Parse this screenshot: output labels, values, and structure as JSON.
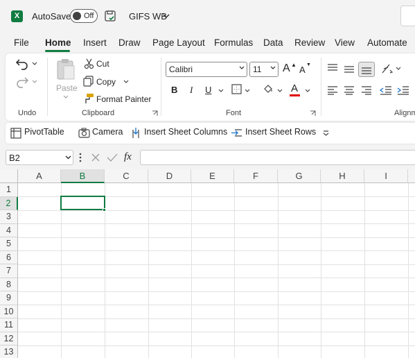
{
  "titlebar": {
    "app_icon_letter": "X",
    "autosave_label": "AutoSave",
    "autosave_state": "Off",
    "document_title": "GIFS WB"
  },
  "tabs": [
    "File",
    "Home",
    "Insert",
    "Draw",
    "Page Layout",
    "Formulas",
    "Data",
    "Review",
    "View",
    "Automate"
  ],
  "active_tab": "Home",
  "ribbon": {
    "undo_group": {
      "label": "Undo"
    },
    "clipboard": {
      "label": "Clipboard",
      "paste": "Paste",
      "cut": "Cut",
      "copy": "Copy",
      "format_painter": "Format Painter"
    },
    "font": {
      "label": "Font",
      "font_name": "Calibri",
      "font_size": "11",
      "bold": "B",
      "italic": "I",
      "underline": "U",
      "grow": "A",
      "shrink": "A",
      "font_color": "A",
      "font_color_value": "#e00000"
    },
    "alignment": {
      "label": "Alignm"
    }
  },
  "quick_access": {
    "items": [
      "PivotTable",
      "Camera",
      "Insert Sheet Columns",
      "Insert Sheet Rows"
    ]
  },
  "formula_bar": {
    "name_box": "B2",
    "fx": "fx",
    "value": ""
  },
  "grid": {
    "columns": [
      "A",
      "B",
      "C",
      "D",
      "E",
      "F",
      "G",
      "H",
      "I"
    ],
    "rows": [
      "1",
      "2",
      "3",
      "4",
      "5",
      "6",
      "7",
      "8",
      "9",
      "10",
      "11",
      "12",
      "13"
    ],
    "selected_column": "B",
    "selected_row": "2"
  },
  "colors": {
    "accent": "#107c41",
    "font_color_bar": "#e00000"
  }
}
